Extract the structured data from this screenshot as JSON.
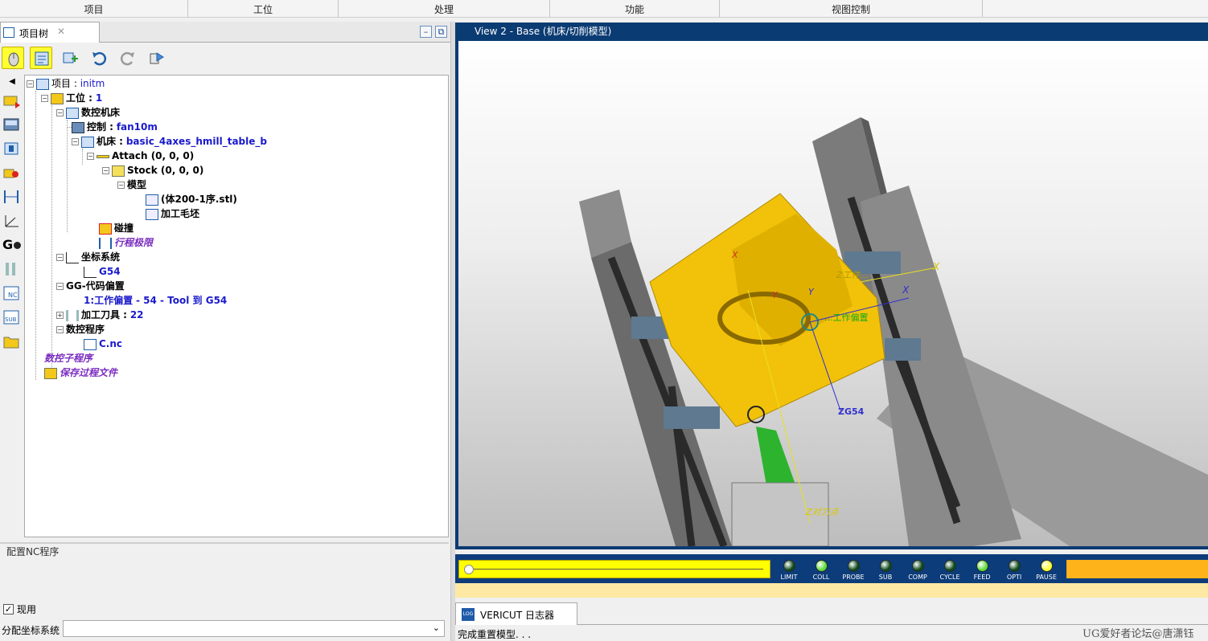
{
  "ribbon": {
    "tabs": [
      "项目",
      "工位",
      "处理",
      "功能",
      "视图控制"
    ]
  },
  "project_tree_tab": {
    "label": "项目树",
    "close": "✕",
    "minimize": "–",
    "restore": "⧉"
  },
  "tree": {
    "project": {
      "label": "项目 :",
      "value": "initm"
    },
    "setup": {
      "label": "工位 :",
      "value": "1"
    },
    "cnc_machine": {
      "label": "数控机床"
    },
    "control": {
      "label": "控制 :",
      "value": "fan10m"
    },
    "machine": {
      "label": "机床 :",
      "value": "basic_4axes_hmill_table_b"
    },
    "attach": {
      "label": "Attach (0, 0, 0)"
    },
    "stock": {
      "label": "Stock (0, 0, 0)"
    },
    "model": {
      "label": "模型"
    },
    "model_file": {
      "label": "(体200-1序.stl)"
    },
    "blank": {
      "label": "加工毛坯"
    },
    "collision": {
      "label": "碰撞"
    },
    "travel_limits": {
      "label": "行程极限"
    },
    "coord_systems": {
      "label": "坐标系统"
    },
    "g54": {
      "label": "G54"
    },
    "gcode_offsets": {
      "label": "G-代码偏置"
    },
    "work_offset": {
      "label": "1:工作偏置",
      "value": "- 54 - Tool 到 G54"
    },
    "tools": {
      "label": "加工刀具 :",
      "value": "22"
    },
    "nc_programs": {
      "label": "数控程序"
    },
    "nc_file": {
      "label": "C.nc"
    },
    "subroutines": {
      "label": "数控子程序"
    },
    "save_process": {
      "label": "保存过程文件"
    }
  },
  "config": {
    "header": "配置NC程序",
    "active_checkbox": {
      "label": "现用",
      "checked": "✓"
    },
    "csys_label": "分配坐标系统",
    "dropdown_arrow": "⌄"
  },
  "view": {
    "title": "View 2 - Base (机床/切削模型)",
    "icon": "V",
    "annotations": {
      "x1": "X",
      "x2": "X",
      "x3": "X",
      "y1": "Y",
      "y2": "Y",
      "workpiece": "Z工件...",
      "offset": "...工作偏置",
      "zg54": "ZG54",
      "tool_point": "Z对刀点"
    }
  },
  "status_leds": [
    {
      "name": "LIMIT",
      "state": "off",
      "color": "#0c4a1a"
    },
    {
      "name": "COLL",
      "state": "on",
      "color": "#5fdc3a"
    },
    {
      "name": "PROBE",
      "state": "off",
      "color": "#0c4a1a"
    },
    {
      "name": "SUB",
      "state": "off",
      "color": "#0c4a1a"
    },
    {
      "name": "COMP",
      "state": "off",
      "color": "#0c4a1a"
    },
    {
      "name": "CYCLE",
      "state": "off",
      "color": "#0c4a1a"
    },
    {
      "name": "FEED",
      "state": "on",
      "color": "#5fdc3a"
    },
    {
      "name": "OPTI",
      "state": "off",
      "color": "#0c4a1a"
    },
    {
      "name": "PAUSE",
      "state": "on",
      "color": "#ffff33"
    }
  ],
  "log": {
    "tab_label": "VERICUT 日志器",
    "tab_icon": "LOG",
    "last_message": "完成重置模型. . ."
  },
  "watermark": "UG爱好者论坛@唐潇钰",
  "colors": {
    "accent": "#0b3b73",
    "part": "#f2c20a",
    "slider": "#ffff00",
    "progress": "#ffb31a"
  }
}
